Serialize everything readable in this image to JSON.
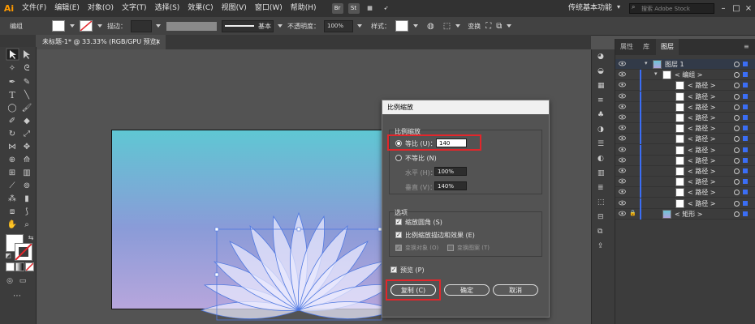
{
  "menubar": {
    "logo": "Ai",
    "items": [
      "文件(F)",
      "编辑(E)",
      "对象(O)",
      "文字(T)",
      "选择(S)",
      "效果(C)",
      "视图(V)",
      "窗口(W)",
      "帮助(H)"
    ],
    "bridge_icon": "Br",
    "stock_icon": "St",
    "workspace": "传统基本功能",
    "search_placeholder": "搜索 Adobe Stock",
    "minimize": "–",
    "restore": "□",
    "close": "×"
  },
  "controlbar": {
    "selection_label": "编组",
    "stroke_label": "描边：",
    "stroke_style": "基本",
    "opacity_label": "不透明度：",
    "opacity_value": "100%",
    "style_label": "样式：",
    "transform_label": "变换"
  },
  "tab": {
    "title": "未标题-1* @ 33.33% (RGB/GPU 预览)",
    "close": "×"
  },
  "dialog": {
    "title": "比例缩放",
    "scale_group": "比例缩放",
    "uniform_label": "等比 (U)：",
    "uniform_value": "140",
    "nonuniform_label": "不等比 (N)",
    "horizontal_label": "水平 (H)：",
    "horizontal_value": "100%",
    "vertical_label": "垂直 (V)：",
    "vertical_value": "140%",
    "options_group": "选项",
    "scale_corners": "缩放圆角 (S)",
    "scale_strokes": "比例缩放描边和效果 (E)",
    "transform_objects": "变换对象 (O)",
    "transform_patterns": "变换图案 (T)",
    "preview": "预览 (P)",
    "copy_button": "复制 (C)",
    "ok_button": "确定",
    "cancel_button": "取消"
  },
  "layers_panel": {
    "tabs": [
      "属性",
      "库",
      "图层"
    ],
    "active_tab": "图层",
    "rows": [
      {
        "name": "图层 1",
        "level": 0
      },
      {
        "name": "< 编组 >",
        "level": 1
      },
      {
        "name": "< 路径 >",
        "level": 2
      },
      {
        "name": "< 路径 >",
        "level": 2
      },
      {
        "name": "< 路径 >",
        "level": 2
      },
      {
        "name": "< 路径 >",
        "level": 2
      },
      {
        "name": "< 路径 >",
        "level": 2
      },
      {
        "name": "< 路径 >",
        "level": 2
      },
      {
        "name": "< 路径 >",
        "level": 2
      },
      {
        "name": "< 路径 >",
        "level": 2
      },
      {
        "name": "< 路径 >",
        "level": 2
      },
      {
        "name": "< 路径 >",
        "level": 2
      },
      {
        "name": "< 路径 >",
        "level": 2
      },
      {
        "name": "< 路径 >",
        "level": 2
      },
      {
        "name": "< 矩形 >",
        "level": 1
      }
    ]
  },
  "colors": {
    "highlight_red": "#e2262b",
    "selection_blue": "#3b6ef5",
    "artboard_top": "#5fc7d3",
    "artboard_bottom": "#b7a6dc"
  }
}
